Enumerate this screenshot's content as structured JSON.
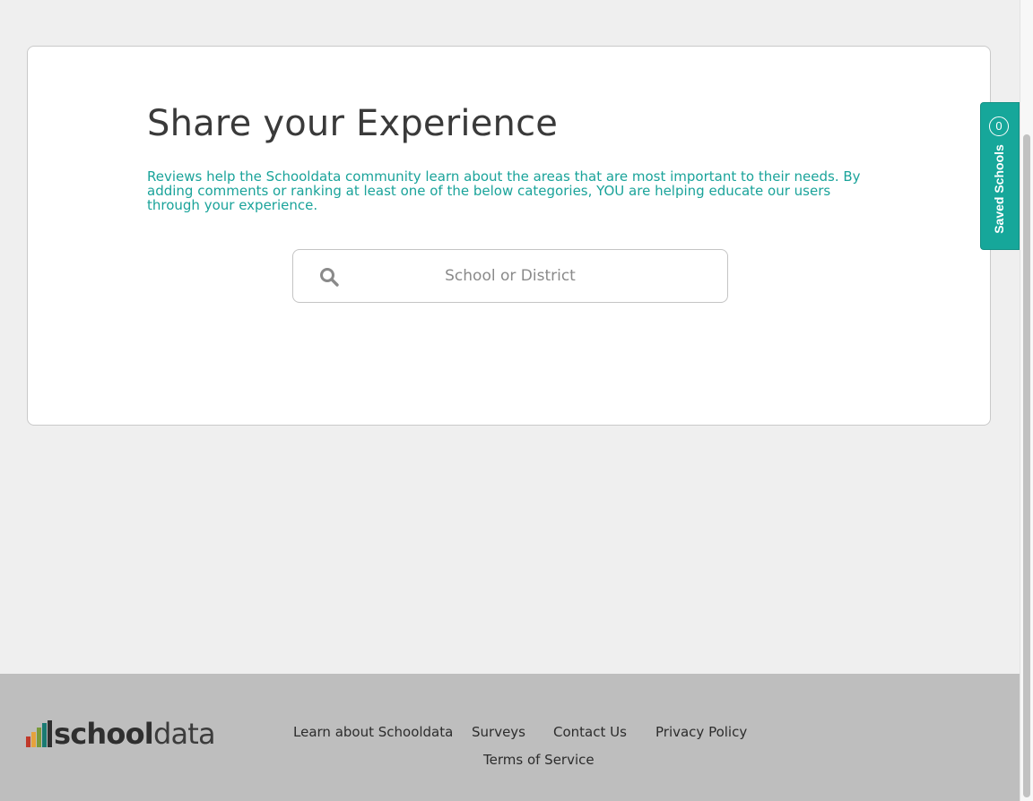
{
  "card": {
    "title": "Share your Experience",
    "description": "Reviews help the Schooldata community learn about the areas that are most important to their needs. By adding comments or ranking at least one of the below categories, YOU are helping educate our users through your experience."
  },
  "search": {
    "placeholder": "School or District",
    "value": "",
    "icon": "search-icon"
  },
  "saved_schools": {
    "label": "Saved Schools",
    "count": "0"
  },
  "footer": {
    "logo": {
      "bold": "school",
      "light": "data"
    },
    "links": {
      "learn": "Learn about Schooldata",
      "surveys": "Surveys",
      "contact": "Contact Us",
      "privacy": "Privacy Policy",
      "terms": "Terms of Service"
    }
  },
  "colors": {
    "accent": "#16a79a",
    "background": "#efefef",
    "footer": "#bebebe",
    "logo_bars": [
      "#c0392b",
      "#e6a23c",
      "#7a9a3a",
      "#1a7a72",
      "#2f2f2f"
    ]
  }
}
